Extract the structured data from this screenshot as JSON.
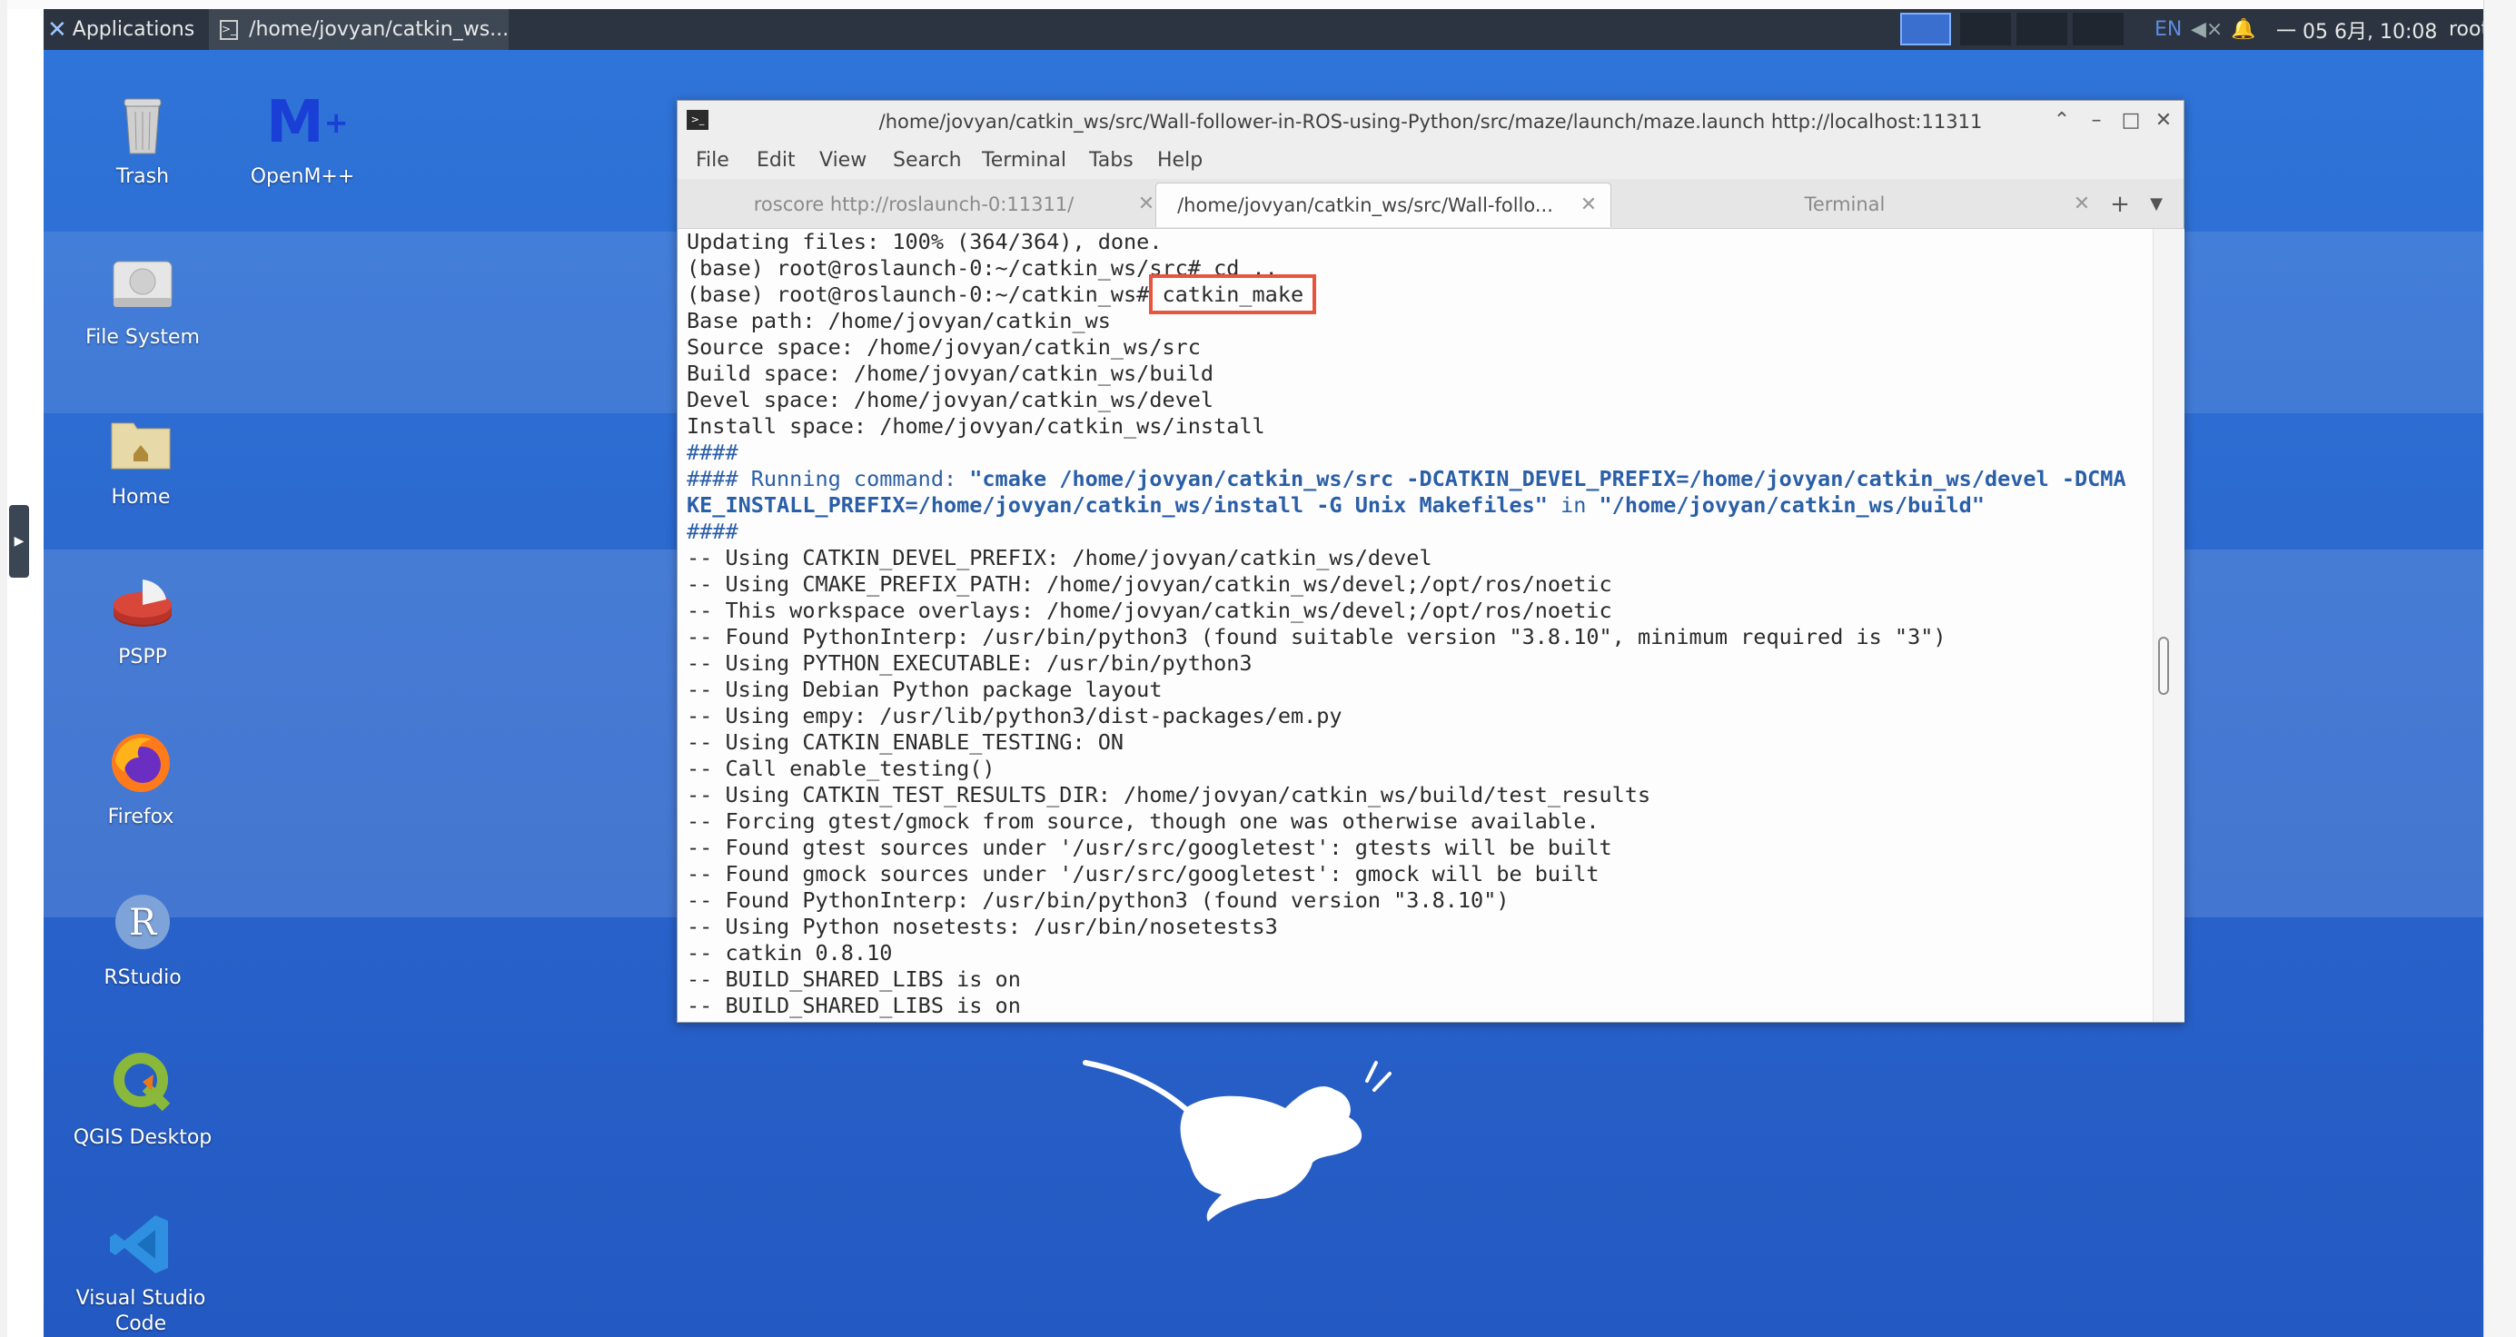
{
  "panel": {
    "applications_label": "Applications",
    "task_label": "/home/jovyan/catkin_ws...",
    "keyboard_layout": "EN",
    "datetime": "一 05 6月, 10:08",
    "user": "root"
  },
  "desktop_icons": [
    {
      "label": "Trash",
      "icon": "trash-icon"
    },
    {
      "label": "OpenM++",
      "icon": "openm-icon"
    },
    {
      "label": "File System",
      "icon": "drive-icon"
    },
    {
      "label": "Home",
      "icon": "home-folder-icon"
    },
    {
      "label": "PSPP",
      "icon": "pspp-icon"
    },
    {
      "label": "Firefox",
      "icon": "firefox-icon"
    },
    {
      "label": "RStudio",
      "icon": "rstudio-icon"
    },
    {
      "label": "QGIS Desktop",
      "icon": "qgis-icon"
    },
    {
      "label": "Visual Studio Code",
      "icon": "vscode-icon"
    }
  ],
  "terminal": {
    "title": "/home/jovyan/catkin_ws/src/Wall-follower-in-ROS-using-Python/src/maze/launch/maze.launch http://localhost:11311",
    "menu": [
      "File",
      "Edit",
      "View",
      "Search",
      "Terminal",
      "Tabs",
      "Help"
    ],
    "tabs": [
      {
        "label": "roscore http://roslaunch-0:11311/",
        "active": false
      },
      {
        "label": "/home/jovyan/catkin_ws/src/Wall-follo...",
        "active": true
      },
      {
        "label": "Terminal",
        "active": false
      }
    ],
    "lines": {
      "l1": "Updating files: 100% (364/364), done.",
      "l2": "(base) root@roslaunch-0:~/catkin_ws/src# cd ..",
      "l3_prompt": "(base) root@roslaunch-0:~/catkin_ws# ",
      "l3_cmd": "catkin_make",
      "l4": "Base path: /home/jovyan/catkin_ws",
      "l5": "Source space: /home/jovyan/catkin_ws/src",
      "l6": "Build space: /home/jovyan/catkin_ws/build",
      "l7": "Devel space: /home/jovyan/catkin_ws/devel",
      "l8": "Install space: /home/jovyan/catkin_ws/install",
      "l9": "####",
      "l10_a": "#### Running command: ",
      "l10_b": "\"cmake /home/jovyan/catkin_ws/src -DCATKIN_DEVEL_PREFIX=/home/jovyan/catkin_ws/devel -DCMA",
      "l11_a": "KE_INSTALL_PREFIX=/home/jovyan/catkin_ws/install -G Unix Makefiles\"",
      "l11_b": " in ",
      "l11_c": "\"/home/jovyan/catkin_ws/build\"",
      "l12": "####",
      "l13": "-- Using CATKIN_DEVEL_PREFIX: /home/jovyan/catkin_ws/devel",
      "l14": "-- Using CMAKE_PREFIX_PATH: /home/jovyan/catkin_ws/devel;/opt/ros/noetic",
      "l15": "-- This workspace overlays: /home/jovyan/catkin_ws/devel;/opt/ros/noetic",
      "l16": "-- Found PythonInterp: /usr/bin/python3 (found suitable version \"3.8.10\", minimum required is \"3\")",
      "l17": "-- Using PYTHON_EXECUTABLE: /usr/bin/python3",
      "l18": "-- Using Debian Python package layout",
      "l19": "-- Using empy: /usr/lib/python3/dist-packages/em.py",
      "l20": "-- Using CATKIN_ENABLE_TESTING: ON",
      "l21": "-- Call enable_testing()",
      "l22": "-- Using CATKIN_TEST_RESULTS_DIR: /home/jovyan/catkin_ws/build/test_results",
      "l23": "-- Forcing gtest/gmock from source, though one was otherwise available.",
      "l24": "-- Found gtest sources under '/usr/src/googletest': gtests will be built",
      "l25": "-- Found gmock sources under '/usr/src/googletest': gmock will be built",
      "l26": "-- Found PythonInterp: /usr/bin/python3 (found version \"3.8.10\")",
      "l27": "-- Using Python nosetests: /usr/bin/nosetests3",
      "l28": "-- catkin 0.8.10",
      "l29": "-- BUILD_SHARED_LIBS is on",
      "l30": "-- BUILD_SHARED_LIBS is on"
    }
  },
  "colors": {
    "desktop": "#2c69cf",
    "panel": "#2b3440",
    "highlight_box": "#e8553f",
    "command_text": "#2a5fa8"
  }
}
